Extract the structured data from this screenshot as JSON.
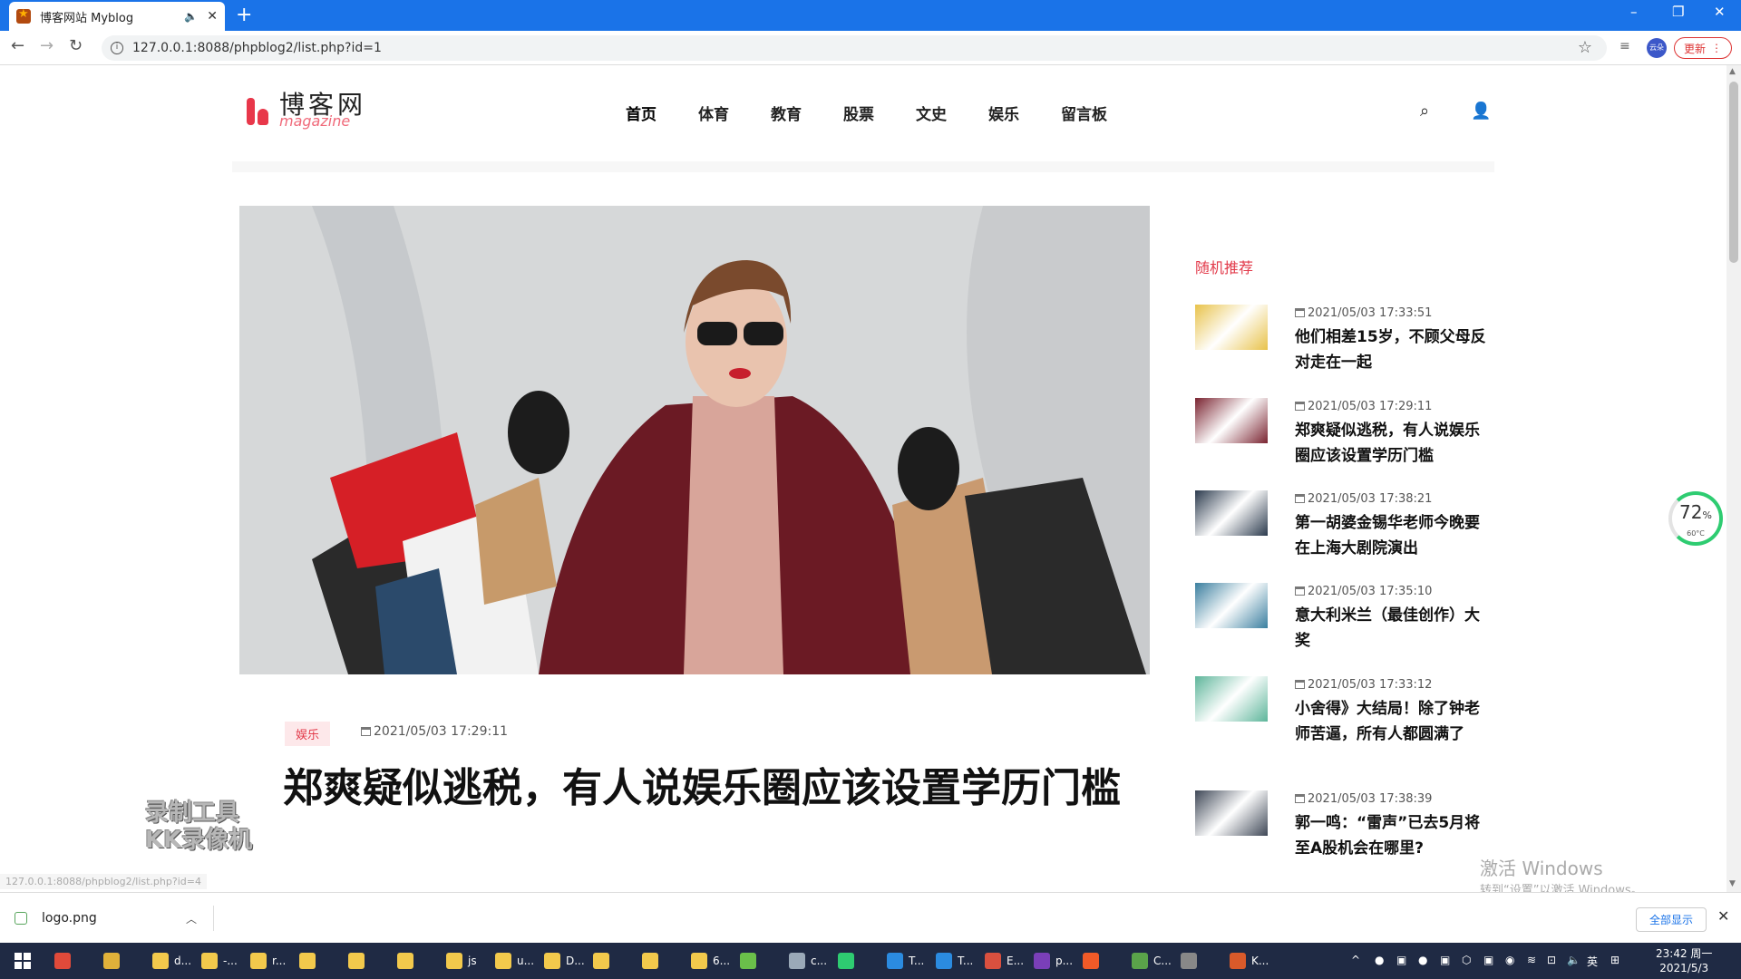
{
  "browser": {
    "tab_title": "博客网站 Myblog",
    "url": "127.0.0.1:8088/phpblog2/list.php?id=1",
    "profile_label": "云朵",
    "update_label": "更新"
  },
  "site": {
    "logo_cn": "博客网",
    "logo_en": "magazine",
    "nav": [
      "首页",
      "体育",
      "教育",
      "股票",
      "文史",
      "娱乐",
      "留言板"
    ]
  },
  "article": {
    "tag": "娱乐",
    "date": "2021/05/03 17:29:11",
    "title": "郑爽疑似逃税，有人说娱乐圈应该设置学历门槛"
  },
  "sidebar": {
    "heading": "随机推荐",
    "items": [
      {
        "date": "2021/05/03 17:33:51",
        "title": "他们相差15岁，不顾父母反对走在一起",
        "color": "#e8c24a"
      },
      {
        "date": "2021/05/03 17:29:11",
        "title": "郑爽疑似逃税，有人说娱乐圈应该设置学历门槛",
        "color": "#7a2330"
      },
      {
        "date": "2021/05/03 17:38:21",
        "title": "第一胡婆金锡华老师今晚要在上海大剧院演出",
        "color": "#2b3a4d"
      },
      {
        "date": "2021/05/03 17:35:10",
        "title": "意大利米兰（最佳创作）大奖",
        "color": "#3a7f9f"
      },
      {
        "date": "2021/05/03 17:33:12",
        "title": "小舍得》大结局！除了钟老师苦逼，所有人都圆满了",
        "color": "#5db59a"
      },
      {
        "date": "2021/05/03 17:38:39",
        "title": "郭一鸣：“雷声”已去5月将至A股机会在哪里?",
        "color": "#3e4756"
      }
    ]
  },
  "overlay": {
    "recorder_line1": "录制工具",
    "recorder_line2": "KK录像机",
    "status_url": "127.0.0.1:8088/phpblog2/list.php?id=4",
    "activate_title": "激活 Windows",
    "activate_sub": "转到“设置”以激活 Windows。",
    "gauge_pct": "72",
    "gauge_unit": "%",
    "gauge_temp": "60°C"
  },
  "download": {
    "file": "logo.png",
    "show_all": "全部显示"
  },
  "taskbar": {
    "apps": [
      {
        "label": "",
        "color": "#e04a3a"
      },
      {
        "label": "",
        "color": "#e0b13a"
      },
      {
        "label": "d...",
        "color": "#f2c94c"
      },
      {
        "label": "-...",
        "color": "#f2c94c"
      },
      {
        "label": "r...",
        "color": "#f2c94c"
      },
      {
        "label": "",
        "color": "#f2c94c"
      },
      {
        "label": "",
        "color": "#f2c94c"
      },
      {
        "label": "",
        "color": "#f2c94c"
      },
      {
        "label": "js",
        "color": "#f2c94c"
      },
      {
        "label": "u...",
        "color": "#f2c94c"
      },
      {
        "label": "D...",
        "color": "#f2c94c"
      },
      {
        "label": "",
        "color": "#f2c94c"
      },
      {
        "label": "",
        "color": "#f2c94c"
      },
      {
        "label": "6...",
        "color": "#f2c94c"
      },
      {
        "label": "",
        "color": "#6ac04a"
      },
      {
        "label": "c...",
        "color": "#9aa9b8"
      },
      {
        "label": "",
        "color": "#2ecc71"
      },
      {
        "label": "T...",
        "color": "#2b8be0"
      },
      {
        "label": "T...",
        "color": "#2b8be0"
      },
      {
        "label": "E...",
        "color": "#d9503f"
      },
      {
        "label": "p...",
        "color": "#7a3fb8"
      },
      {
        "label": "",
        "color": "#f05a28"
      },
      {
        "label": "C...",
        "color": "#5aa34a"
      },
      {
        "label": "",
        "color": "#888888"
      },
      {
        "label": "K...",
        "color": "#d95a2a"
      }
    ],
    "ime": "英",
    "time": "23:42 周一",
    "date": "2021/5/3"
  }
}
